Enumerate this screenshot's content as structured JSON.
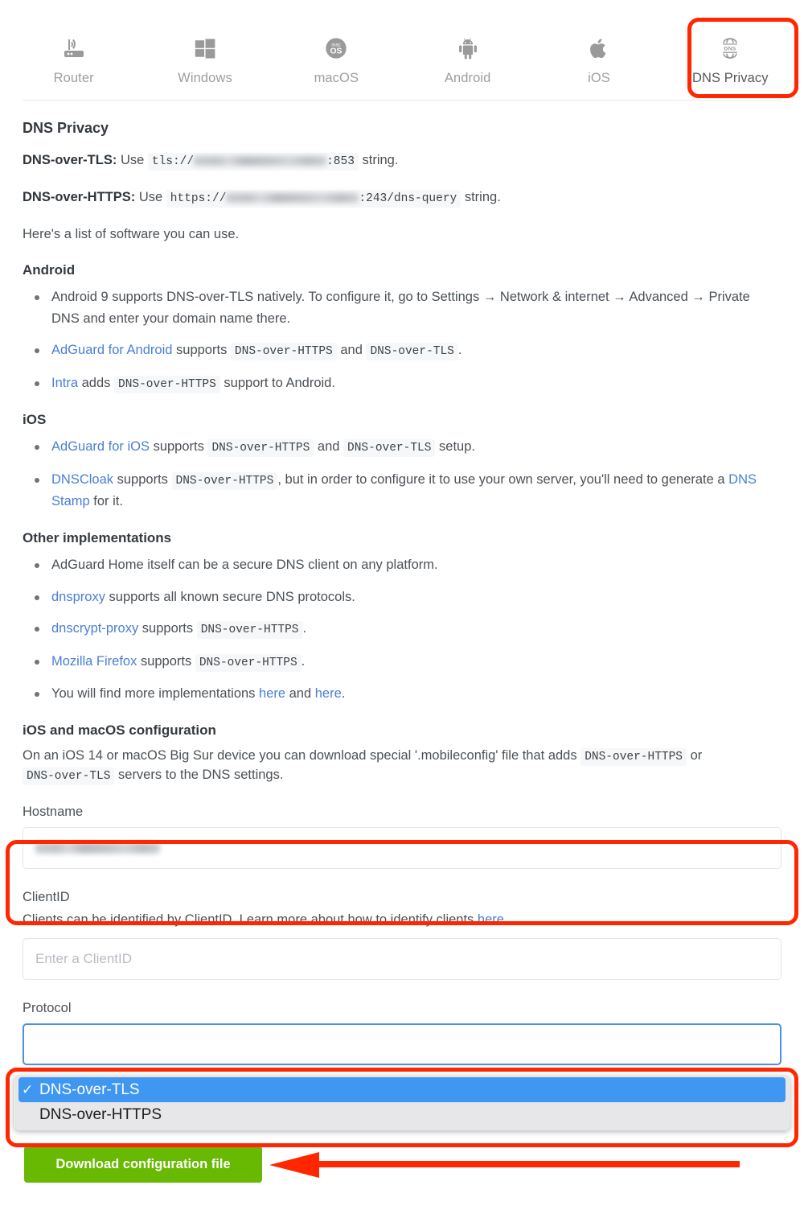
{
  "tabs": [
    {
      "id": "router",
      "label": "Router",
      "icon": "router-icon",
      "active": false
    },
    {
      "id": "windows",
      "label": "Windows",
      "icon": "windows-icon",
      "active": false
    },
    {
      "id": "macos",
      "label": "macOS",
      "icon": "macos-icon",
      "active": false
    },
    {
      "id": "android",
      "label": "Android",
      "icon": "android-icon",
      "active": false
    },
    {
      "id": "ios",
      "label": "iOS",
      "icon": "apple-icon",
      "active": false
    },
    {
      "id": "dns",
      "label": "DNS Privacy",
      "icon": "dns-globe-icon",
      "active": true
    }
  ],
  "page": {
    "heading": "DNS Privacy",
    "dot": "DNS-over-TLS:",
    "doh": "DNS-over-HTTPS:",
    "use": "Use",
    "string_suffix": "string.",
    "dot_code_prefix": "tls://",
    "dot_code_suffix": ":853",
    "doh_code_prefix": "https://",
    "doh_code_suffix": ":243/dns-query",
    "software_intro": "Here's a list of software you can use."
  },
  "android": {
    "heading": "Android",
    "items": [
      {
        "text": "Android 9 supports DNS-over-TLS natively. To configure it, go to Settings → Network & internet → Advanced → Private DNS and enter your domain name there."
      },
      {
        "link": "AdGuard for Android",
        "mid": "supports",
        "code1": "DNS-over-HTTPS",
        "conj": "and",
        "code2": "DNS-over-TLS",
        "tail": "."
      },
      {
        "link": "Intra",
        "mid": "adds",
        "code1": "DNS-over-HTTPS",
        "tail": "support to Android."
      }
    ]
  },
  "ios": {
    "heading": "iOS",
    "items": [
      {
        "link": "AdGuard for iOS",
        "mid": "supports",
        "code1": "DNS-over-HTTPS",
        "conj": "and",
        "code2": "DNS-over-TLS",
        "tail": "setup."
      },
      {
        "link": "DNSCloak",
        "mid": "supports",
        "code1": "DNS-over-HTTPS",
        "tail": ", but in order to configure it to use your own server, you'll need to generate a ",
        "link2": "DNS Stamp",
        "tail2": " for it."
      }
    ]
  },
  "other": {
    "heading": "Other implementations",
    "items": [
      {
        "text": "AdGuard Home itself can be a secure DNS client on any platform."
      },
      {
        "link": "dnsproxy",
        "tail": "supports all known secure DNS protocols."
      },
      {
        "link": "dnscrypt-proxy",
        "mid": "supports",
        "code1": "DNS-over-HTTPS",
        "tail": "."
      },
      {
        "link": "Mozilla Firefox",
        "mid": "supports",
        "code1": "DNS-over-HTTPS",
        "tail": "."
      },
      {
        "text": "You will find more implementations ",
        "link": "here",
        "mid": " and ",
        "link2": "here",
        "tail": "."
      }
    ]
  },
  "config": {
    "heading": "iOS and macOS configuration",
    "desc_a": "On an iOS 14 or macOS Big Sur device you can download special '.mobileconfig' file that adds",
    "code1": "DNS-over-HTTPS",
    "desc_b": "or",
    "code2": "DNS-over-TLS",
    "desc_c": "servers to the DNS settings."
  },
  "form": {
    "hostname_label": "Hostname",
    "hostname_value": "",
    "clientid_label": "ClientID",
    "clientid_help_a": "Clients can be identified by ClientID. Learn more about how to identify clients ",
    "clientid_help_link": "here",
    "clientid_help_b": ".",
    "clientid_placeholder": "Enter a ClientID",
    "protocol_label": "Protocol",
    "protocol_options": [
      {
        "label": "DNS-over-TLS",
        "selected": true,
        "check": "✓"
      },
      {
        "label": "DNS-over-HTTPS",
        "selected": false,
        "check": ""
      }
    ],
    "download_label": "Download configuration file"
  },
  "colors": {
    "annotation_red": "#ff2600",
    "download_green": "#67b901",
    "selection_blue": "#3f97f2",
    "link_blue": "#4a7fd4"
  }
}
